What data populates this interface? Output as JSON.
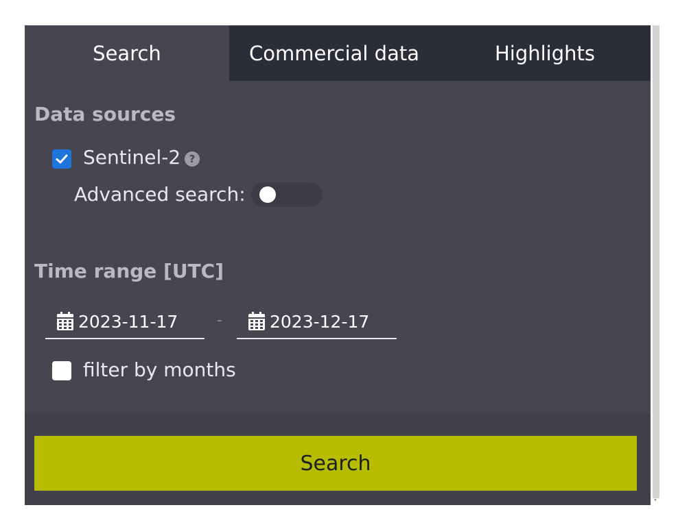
{
  "tabs": [
    {
      "label": "Search",
      "active": true
    },
    {
      "label": "Commercial data",
      "active": false
    },
    {
      "label": "Highlights",
      "active": false
    }
  ],
  "data_sources": {
    "title": "Data sources",
    "sentinel": {
      "label": "Sentinel-2",
      "checked": true,
      "help_icon": "question-circle-icon"
    },
    "advanced_search": {
      "label": "Advanced search:",
      "enabled": false
    }
  },
  "time_range": {
    "title": "Time range [UTC]",
    "from": "2023-11-17",
    "separator": "-",
    "to": "2023-12-17",
    "calendar_icon": "calendar-icon",
    "filter_by_months": {
      "label": "filter by months",
      "checked": false
    }
  },
  "search_button": {
    "label": "Search"
  },
  "colors": {
    "panel_bg": "#464651",
    "tabbar_bg": "#2b2d38",
    "accent": "#b6bd00",
    "checkbox_checked": "#1e74d9"
  }
}
